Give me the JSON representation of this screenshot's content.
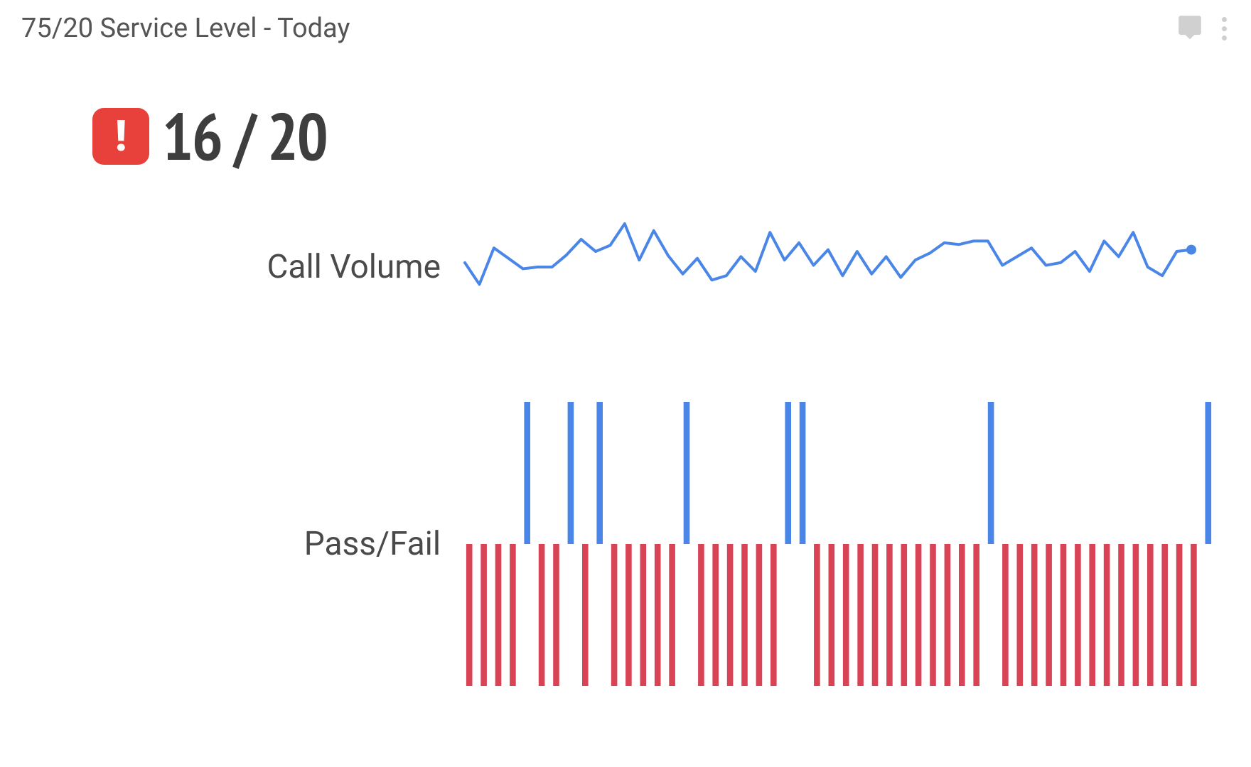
{
  "header": {
    "title": "75/20 Service Level - Today"
  },
  "alert": {
    "glyph": "!"
  },
  "summary": {
    "numerator": 16,
    "separator": "/",
    "denominator": 20
  },
  "labels": {
    "call_volume": "Call Volume",
    "pass_fail": "Pass/Fail"
  },
  "colors": {
    "line": "#4a86e8",
    "pass": "#4a86e8",
    "fail": "#d94356",
    "alert": "#e8403a"
  },
  "chart_data": [
    {
      "type": "line",
      "title": "Call Volume",
      "series": [
        {
          "name": "Call Volume",
          "values": [
            55,
            30,
            72,
            60,
            48,
            50,
            50,
            64,
            82,
            68,
            75,
            100,
            58,
            92,
            63,
            42,
            60,
            35,
            40,
            62,
            45,
            90,
            58,
            78,
            52,
            70,
            40,
            68,
            42,
            62,
            38,
            58,
            66,
            78,
            76,
            80,
            80,
            52,
            62,
            72,
            52,
            55,
            68,
            45,
            80,
            62,
            90,
            50,
            40,
            68,
            70
          ]
        }
      ],
      "ylim": [
        0,
        100
      ],
      "ylabel": "",
      "xlabel": ""
    },
    {
      "type": "bar",
      "title": "Pass/Fail",
      "categories_note": "one bar per time-slot; 1 = pass (blue, up), -1 = fail (red, down)",
      "series": [
        {
          "name": "Pass/Fail",
          "values": [
            -1,
            -1,
            -1,
            -1,
            1,
            -1,
            -1,
            1,
            -1,
            1,
            -1,
            -1,
            -1,
            -1,
            -1,
            1,
            -1,
            -1,
            -1,
            -1,
            -1,
            -1,
            1,
            1,
            -1,
            -1,
            -1,
            -1,
            -1,
            -1,
            -1,
            -1,
            -1,
            -1,
            -1,
            -1,
            1,
            -1,
            -1,
            -1,
            -1,
            -1,
            -1,
            -1,
            -1,
            -1,
            -1,
            -1,
            -1,
            -1,
            -1,
            1
          ]
        }
      ],
      "ylim": [
        -1,
        1
      ],
      "ylabel": "",
      "xlabel": ""
    }
  ]
}
